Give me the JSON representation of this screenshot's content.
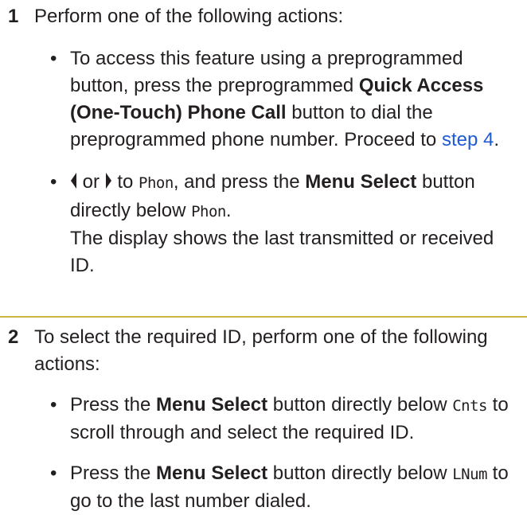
{
  "step1": {
    "number": "1",
    "intro": "Perform one of the following actions:",
    "bullet_a": {
      "text1": "To access this feature using a preprogrammed button, press the preprogrammed ",
      "bold": "Quick Access (One-Touch) Phone Call",
      "text2": " button to dial the preprogrammed phone number. Proceed to ",
      "link": "step 4",
      "text3": "."
    },
    "bullet_b": {
      "or": " or ",
      "to": " to ",
      "phon1": "Phon",
      "text1": ", and press the ",
      "bold": "Menu Select",
      "text2": " button directly below ",
      "phon2": "Phon",
      "text3": ".",
      "note": "The display shows the last transmitted or received ID."
    }
  },
  "step2": {
    "number": "2",
    "intro": "To select the required ID, perform one of the following actions:",
    "bullet_a": {
      "text1": "Press the ",
      "bold": "Menu Select",
      "text2": " button directly below ",
      "mono": "Cnts",
      "text3": " to scroll through and select the required ID."
    },
    "bullet_b": {
      "text1": "Press the ",
      "bold": "Menu Select",
      "text2": " button directly below ",
      "mono": "LNum",
      "text3": " to go to the last number dialed."
    }
  },
  "bullet_char": "•",
  "colors": {
    "text": "#231f20",
    "link": "#1f5ad6",
    "divider": "#c9b53f"
  },
  "icons": [
    "left-arrow-icon",
    "right-arrow-icon"
  ]
}
